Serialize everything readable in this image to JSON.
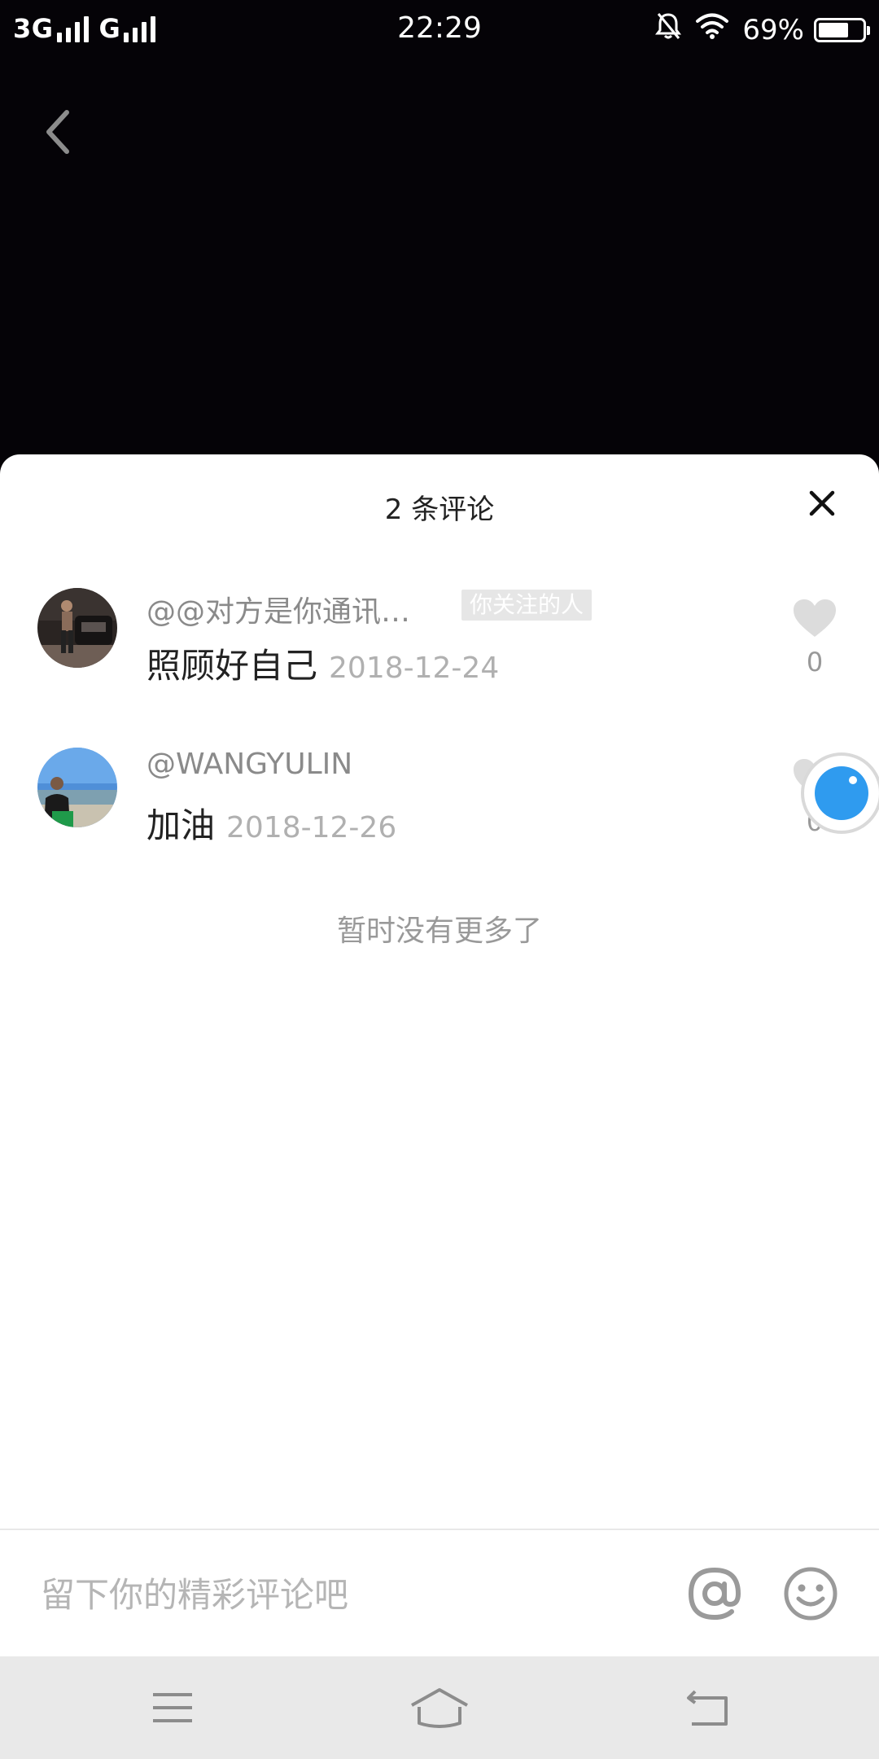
{
  "status_bar": {
    "network1": "3G",
    "network2": "G",
    "time": "22:29",
    "battery": "69%",
    "battery_level": 0.69
  },
  "icons": {
    "back": "chevron-left-icon",
    "close": "close-icon",
    "like": "heart-icon",
    "mention": "at-icon",
    "emoji": "smiley-icon",
    "menu": "menu-icon",
    "home": "home-icon",
    "back_nav": "back-arrow-icon"
  },
  "colors": {
    "background": "#050307",
    "sheet": "#ffffff",
    "accent_ball": "#2f9bef",
    "nav_bar": "#e9e9e9"
  },
  "sheet": {
    "title": "2 条评论"
  },
  "comments": [
    {
      "author": "@@对方是你通讯…",
      "tag": "你关注的人",
      "text": "照顾好自己",
      "date": "2018-12-24",
      "likes": "0"
    },
    {
      "author": "@WANGYULIN",
      "tag": "",
      "text": "加油",
      "date": "2018-12-26",
      "likes": "0"
    }
  ],
  "no_more": "暂时没有更多了",
  "input": {
    "placeholder": "留下你的精彩评论吧",
    "value": ""
  }
}
